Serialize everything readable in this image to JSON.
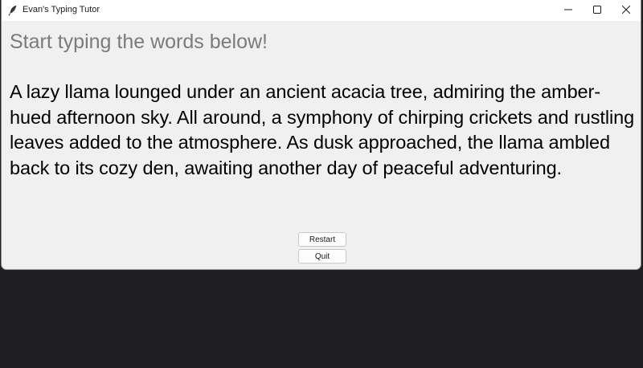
{
  "window": {
    "title": "Evan's Typing Tutor"
  },
  "titlebar_controls": {
    "minimize_icon": "minimize-icon",
    "maximize_icon": "maximize-icon",
    "close_icon": "close-icon"
  },
  "main": {
    "prompt": "Start typing the words below!",
    "passage": "A lazy llama lounged under an ancient acacia tree, admiring the amber-hued afternoon sky. All around, a symphony of chirping crickets and rustling leaves added to the atmosphere. As dusk approached, the llama ambled back to its cozy den, awaiting another day of peaceful adventuring."
  },
  "buttons": {
    "restart_label": "Restart",
    "quit_label": "Quit"
  },
  "colors": {
    "desktop_background": "#1f1e20",
    "window_background": "#f0f0f0",
    "prompt_text": "#7b7b7b",
    "passage_text": "#000000"
  }
}
